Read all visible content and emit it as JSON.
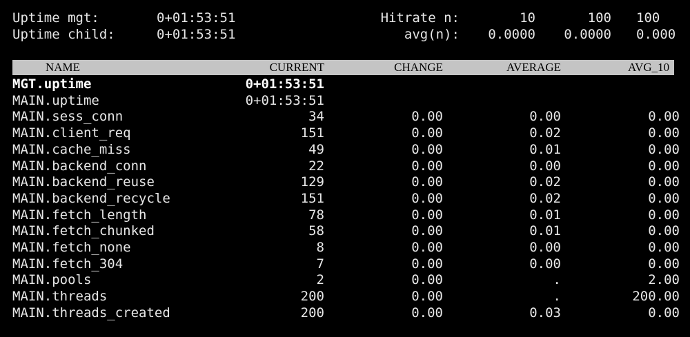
{
  "top": {
    "uptime_mgt_label": "Uptime mgt:",
    "uptime_mgt_value": "0+01:53:51",
    "uptime_child_label": "Uptime child:",
    "uptime_child_value": "0+01:53:51",
    "hitrate_label": "Hitrate n:",
    "hitrate_values": [
      "10",
      "100",
      "100"
    ],
    "avg_label": "avg(n):",
    "avg_values": [
      "0.0000",
      "0.0000",
      "0.000"
    ]
  },
  "columns": [
    "NAME",
    "CURRENT",
    "CHANGE",
    "AVERAGE",
    "AVG_10"
  ],
  "rows": [
    {
      "name": "MGT.uptime",
      "current": "0+01:53:51",
      "change": "",
      "average": "",
      "avg10": ""
    },
    {
      "name": "MAIN.uptime",
      "current": "0+01:53:51",
      "change": "",
      "average": "",
      "avg10": ""
    },
    {
      "name": "MAIN.sess_conn",
      "current": "34",
      "change": "0.00",
      "average": "0.00",
      "avg10": "0.00"
    },
    {
      "name": "MAIN.client_req",
      "current": "151",
      "change": "0.00",
      "average": "0.02",
      "avg10": "0.00"
    },
    {
      "name": "MAIN.cache_miss",
      "current": "49",
      "change": "0.00",
      "average": "0.01",
      "avg10": "0.00"
    },
    {
      "name": "MAIN.backend_conn",
      "current": "22",
      "change": "0.00",
      "average": "0.00",
      "avg10": "0.00"
    },
    {
      "name": "MAIN.backend_reuse",
      "current": "129",
      "change": "0.00",
      "average": "0.02",
      "avg10": "0.00"
    },
    {
      "name": "MAIN.backend_recycle",
      "current": "151",
      "change": "0.00",
      "average": "0.02",
      "avg10": "0.00"
    },
    {
      "name": "MAIN.fetch_length",
      "current": "78",
      "change": "0.00",
      "average": "0.01",
      "avg10": "0.00"
    },
    {
      "name": "MAIN.fetch_chunked",
      "current": "58",
      "change": "0.00",
      "average": "0.01",
      "avg10": "0.00"
    },
    {
      "name": "MAIN.fetch_none",
      "current": "8",
      "change": "0.00",
      "average": "0.00",
      "avg10": "0.00"
    },
    {
      "name": "MAIN.fetch_304",
      "current": "7",
      "change": "0.00",
      "average": "0.00",
      "avg10": "0.00"
    },
    {
      "name": "MAIN.pools",
      "current": "2",
      "change": "0.00",
      "average": ".",
      "avg10": "2.00"
    },
    {
      "name": "MAIN.threads",
      "current": "200",
      "change": "0.00",
      "average": ".",
      "avg10": "200.00"
    },
    {
      "name": "MAIN.threads_created",
      "current": "200",
      "change": "0.00",
      "average": "0.03",
      "avg10": "0.00"
    }
  ],
  "colors": {
    "background": "#000000",
    "text": "#e6e6e6",
    "header_bar": "#c4c4c4",
    "header_text": "#000000"
  }
}
